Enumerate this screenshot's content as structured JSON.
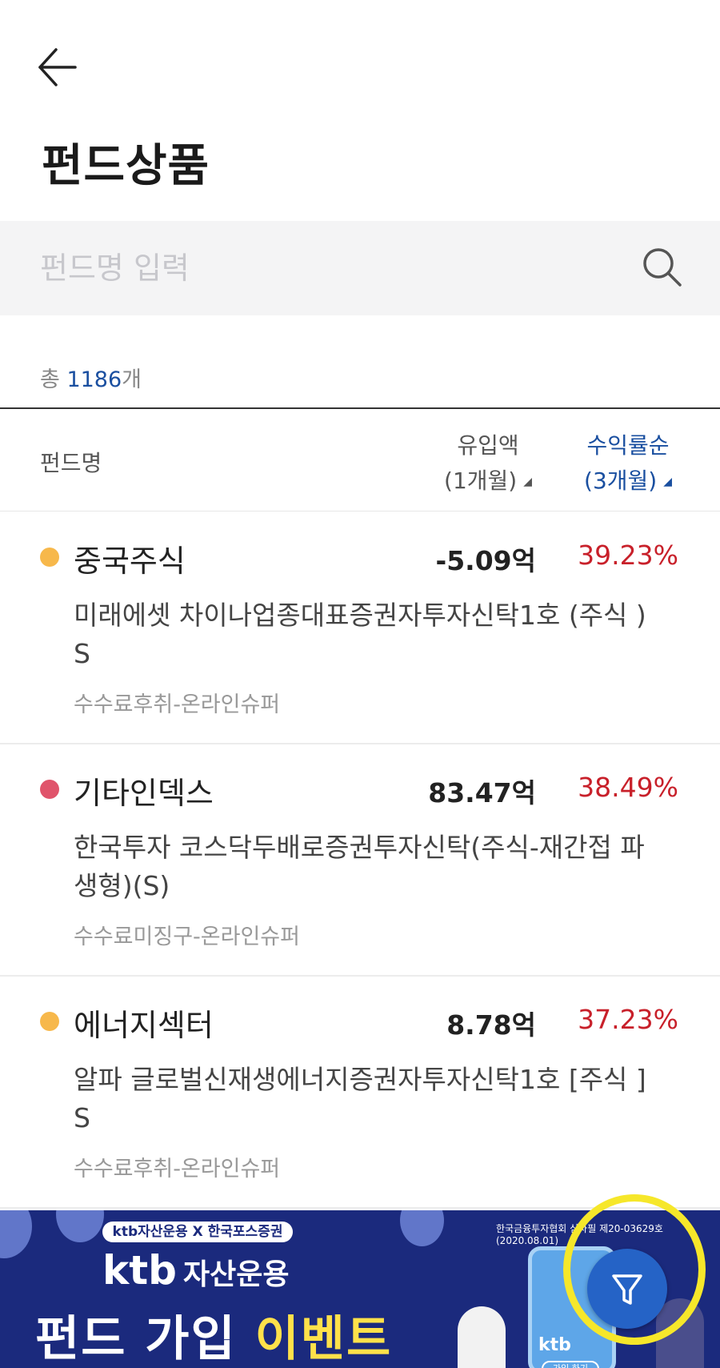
{
  "header": {
    "back_icon": "arrow-left-icon",
    "title": "펀드상품"
  },
  "search": {
    "placeholder": "펀드명 입력",
    "icon": "search-icon"
  },
  "summary": {
    "prefix": "총 ",
    "count": "1186",
    "suffix": "개"
  },
  "list_header": {
    "name_col": "펀드명",
    "inflow_col_line1": "유입액",
    "inflow_col_line2": "(1개월)",
    "return_col_line1": "수익률순",
    "return_col_line2": "(3개월)",
    "sort_icon": "triangle-sort-icon"
  },
  "funds": [
    {
      "category": "중국주식",
      "dot_color": "#f7b84b",
      "inflow": "-5.09억",
      "return": "39.23%",
      "name": "미래에셋 차이나업종대표증권자투자신탁1호 (주식 ) S",
      "fee_type": "수수료후취-온라인슈퍼"
    },
    {
      "category": "기타인덱스",
      "dot_color": "#e0546b",
      "inflow": "83.47억",
      "return": "38.49%",
      "name": "한국투자 코스닥두배로증권투자신탁(주식-재간접 파생형)(S)",
      "fee_type": "수수료미징구-온라인슈퍼"
    },
    {
      "category": "에너지섹터",
      "dot_color": "#f7b84b",
      "inflow": "8.78억",
      "return": "37.23%",
      "name": "알파 글로벌신재생에너지증권자투자신탁1호 [주식 ] S",
      "fee_type": "수수료후취-온라인슈퍼"
    }
  ],
  "banner": {
    "tag": "ktb자산운용 X 한국포스증권",
    "brand": "ktb",
    "brand_sub": "자산운용",
    "headline_main": "펀드 가입 ",
    "headline_highlight": "이벤트",
    "legal": "한국금융투자협회 심사필 제20-03629호(2020.08.01)",
    "phone_text": "ktb",
    "phone_button": "가입 하기"
  },
  "fab": {
    "icon": "filter-icon"
  },
  "colors": {
    "accent_blue": "#1a4fa0",
    "return_red": "#c8202a",
    "banner_bg": "#1b2a7d",
    "highlight_yellow": "#f6e72a"
  }
}
